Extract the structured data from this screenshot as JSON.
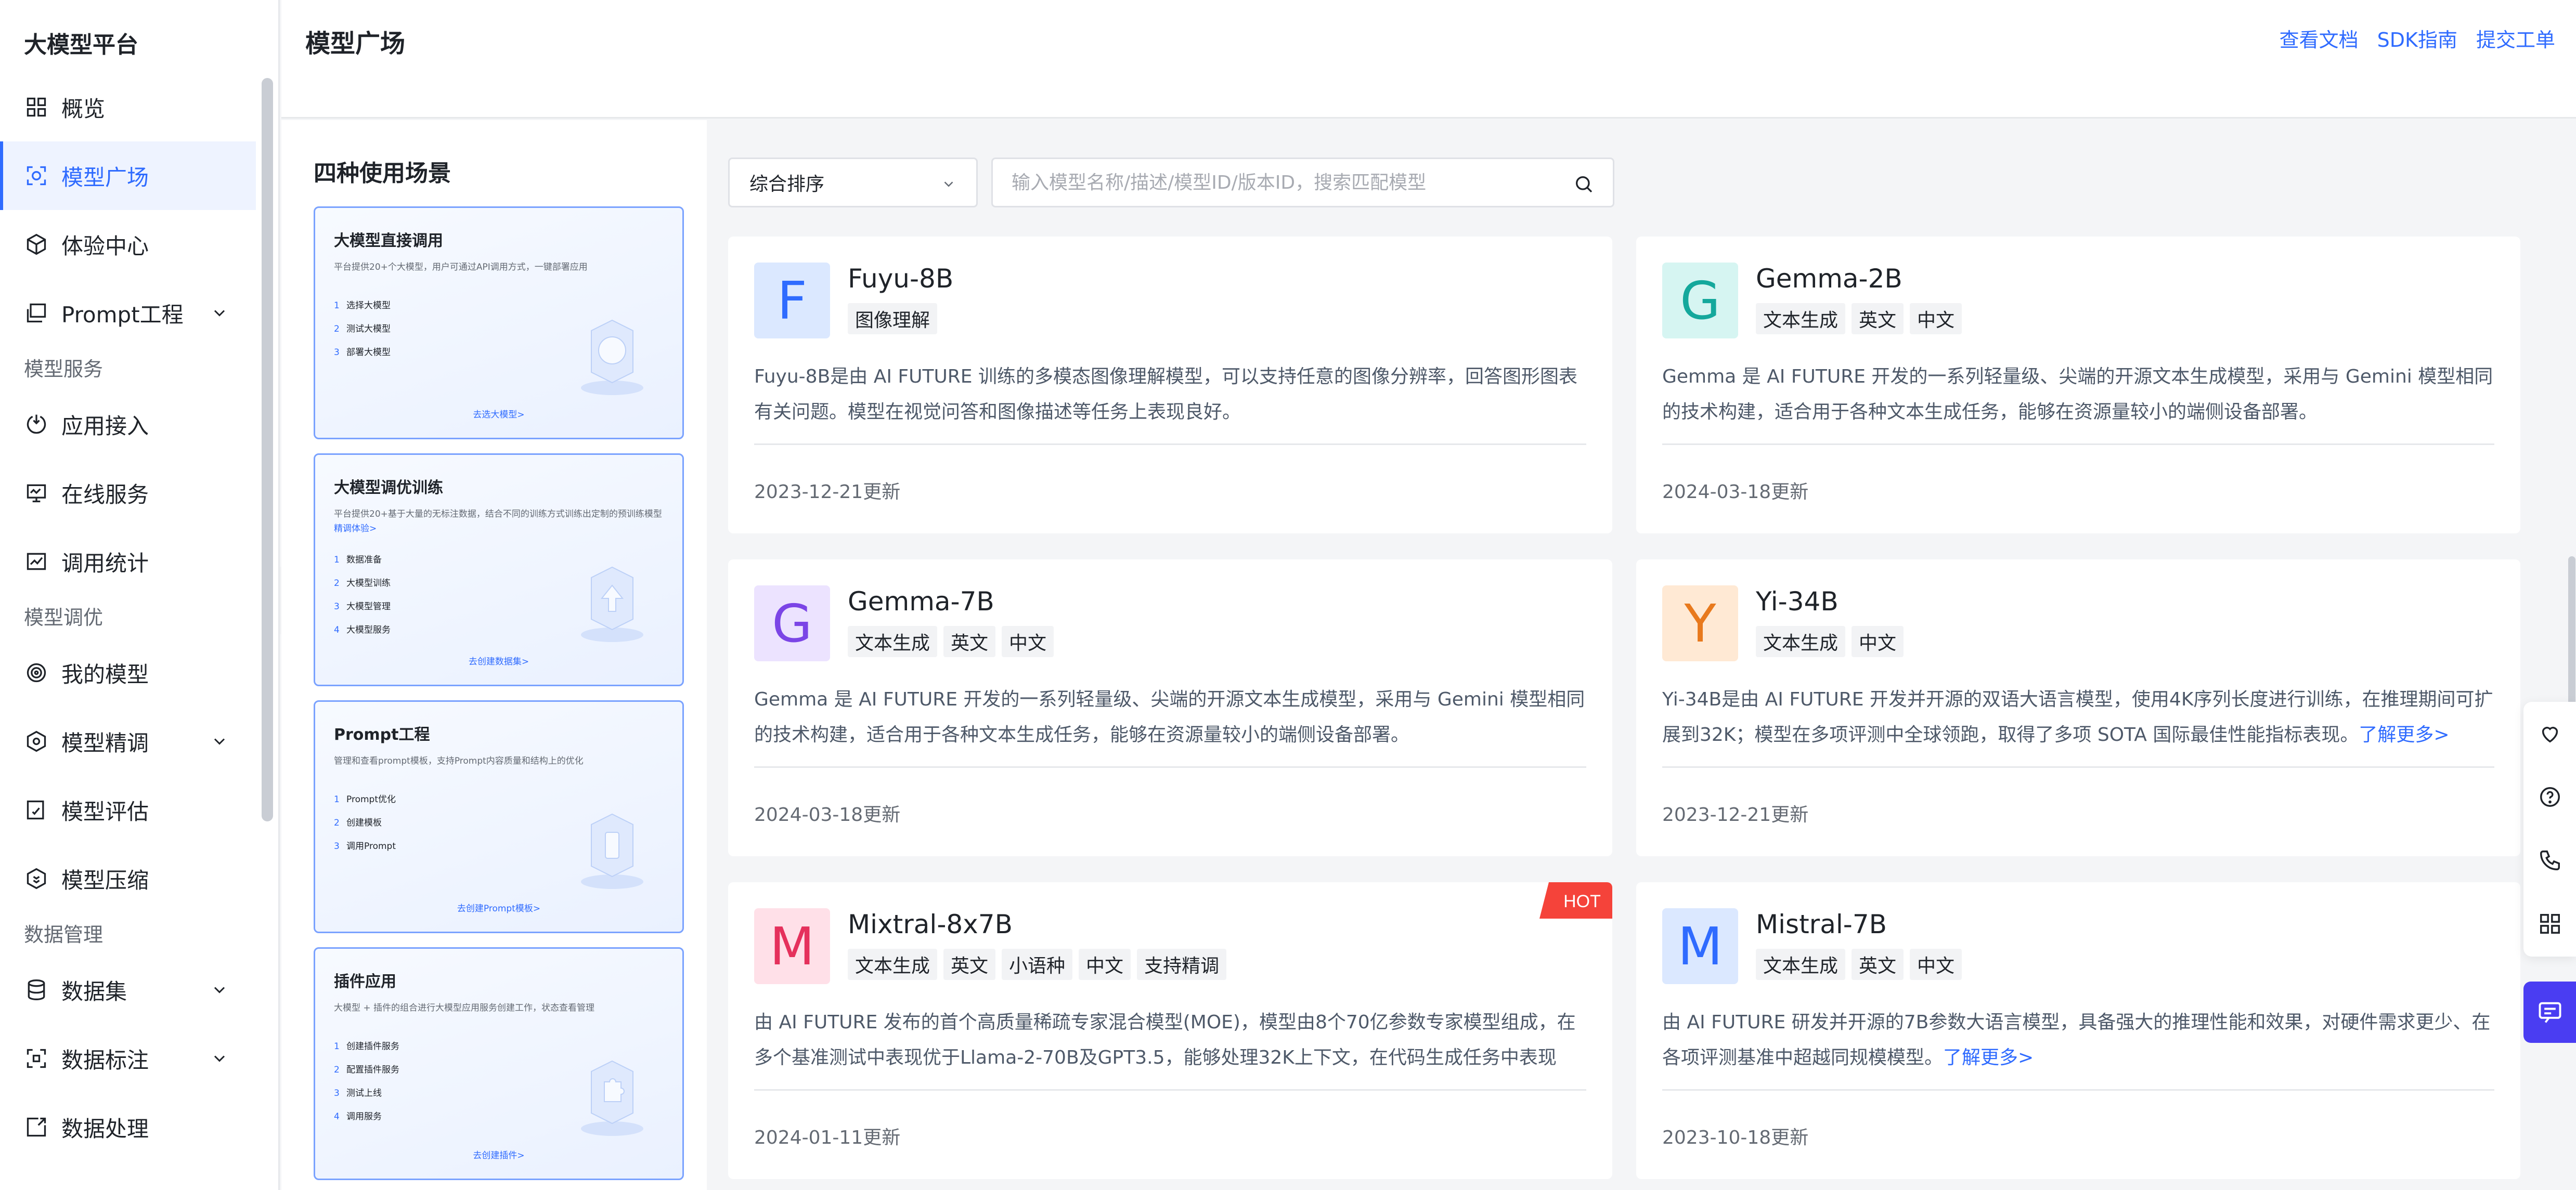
{
  "sidebar": {
    "title": "大模型平台",
    "items": [
      {
        "label": "概览"
      },
      {
        "label": "模型广场"
      },
      {
        "label": "体验中心"
      },
      {
        "label": "Prompt工程"
      },
      {
        "label": "应用接入"
      },
      {
        "label": "在线服务"
      },
      {
        "label": "调用统计"
      },
      {
        "label": "我的模型"
      },
      {
        "label": "模型精调"
      },
      {
        "label": "模型评估"
      },
      {
        "label": "模型压缩"
      },
      {
        "label": "数据集"
      },
      {
        "label": "数据标注"
      },
      {
        "label": "数据处理"
      }
    ],
    "groups": [
      "模型服务",
      "模型调优",
      "数据管理"
    ]
  },
  "header": {
    "title": "模型广场",
    "links": [
      "查看文档",
      "SDK指南",
      "提交工单"
    ]
  },
  "scenarios": {
    "heading": "四种使用场景",
    "cards": [
      {
        "title": "大模型直接调用",
        "desc": "平台提供20+个大模型，用户可通过API调用方式，一键部署应用",
        "desc_link": "",
        "steps": [
          "选择大模型",
          "测试大模型",
          "部署大模型"
        ],
        "link": "去选大模型>"
      },
      {
        "title": "大模型调优训练",
        "desc": "平台提供20+基于大量的无标注数据，结合不同的训练方式训练出定制的预训练模型 ",
        "desc_link": "精调体验>",
        "steps": [
          "数据准备",
          "大模型训练",
          "大模型管理",
          "大模型服务"
        ],
        "link": "去创建数据集>"
      },
      {
        "title": "Prompt工程",
        "desc": "管理和查看prompt模板，支持Prompt内容质量和结构上的优化",
        "desc_link": "",
        "steps": [
          "Prompt优化",
          "创建模板",
          "调用Prompt"
        ],
        "link": "去创建Prompt模板>"
      },
      {
        "title": "插件应用",
        "desc": "大模型 + 插件的组合进行大模型应用服务创建工作，状态查看管理",
        "desc_link": "",
        "steps": [
          "创建插件服务",
          "配置插件服务",
          "测试上线",
          "调用服务"
        ],
        "link": "去创建插件>"
      }
    ]
  },
  "toolbar": {
    "sort_label": "综合排序",
    "search_placeholder": "输入模型名称/描述/模型ID/版本ID，搜索匹配模型"
  },
  "models": [
    {
      "letter": "F",
      "name": "Fuyu-8B",
      "tags": [
        "图像理解"
      ],
      "desc": "Fuyu-8B是由 AI FUTURE 训练的多模态图像理解模型，可以支持任意的图像分辨率，回答图形图表有关问题。模型在视觉问答和图像描述等任务上表现良好。",
      "more": "",
      "date": "2023-12-21更新",
      "hot": ""
    },
    {
      "letter": "G",
      "name": "Gemma-2B",
      "tags": [
        "文本生成",
        "英文",
        "中文"
      ],
      "desc": "Gemma 是 AI FUTURE 开发的一系列轻量级、尖端的开源文本生成模型，采用与 Gemini 模型相同的技术构建，适合用于各种文本生成任务，能够在资源量较小的端侧设备部署。",
      "more": "",
      "date": "2024-03-18更新",
      "hot": ""
    },
    {
      "letter": "G",
      "name": "Gemma-7B",
      "tags": [
        "文本生成",
        "英文",
        "中文"
      ],
      "desc": "Gemma 是 AI FUTURE 开发的一系列轻量级、尖端的开源文本生成模型，采用与 Gemini 模型相同的技术构建，适合用于各种文本生成任务，能够在资源量较小的端侧设备部署。",
      "more": "",
      "date": "2024-03-18更新",
      "hot": ""
    },
    {
      "letter": "Y",
      "name": "Yi-34B",
      "tags": [
        "文本生成",
        "中文"
      ],
      "desc": "Yi-34B是由 AI FUTURE 开发并开源的双语大语言模型，使用4K序列长度进行训练，在推理期间可扩展到32K；模型在多项评测中全球领跑，取得了多项 SOTA 国际最佳性能指标表现。",
      "more": "了解更多>",
      "date": "2023-12-21更新",
      "hot": ""
    },
    {
      "letter": "M",
      "name": "Mixtral-8x7B",
      "tags": [
        "文本生成",
        "英文",
        "小语种",
        "中文",
        "支持精调"
      ],
      "desc": "由 AI FUTURE 发布的首个高质量稀疏专家混合模型(MOE)，模型由8个70亿参数专家模型组成，在多个基准测试中表现优于Llama-2-70B及GPT3.5，能够处理32K上下文，在代码生成任务中表现尤...",
      "more": "",
      "date": "2024-01-11更新",
      "hot": "HOT"
    },
    {
      "letter": "M",
      "name": "Mistral-7B",
      "tags": [
        "文本生成",
        "英文",
        "中文"
      ],
      "desc": "由 AI FUTURE 研发并开源的7B参数大语言模型，具备强大的推理性能和效果，对硬件需求更少、在各项评测基准中超越同规模模型。",
      "more": "了解更多>",
      "date": "2023-10-18更新",
      "hot": ""
    }
  ],
  "colors": {
    "accent": "#2f6bff",
    "hot": "#f5433a",
    "chat_button": "#4a3df2"
  }
}
